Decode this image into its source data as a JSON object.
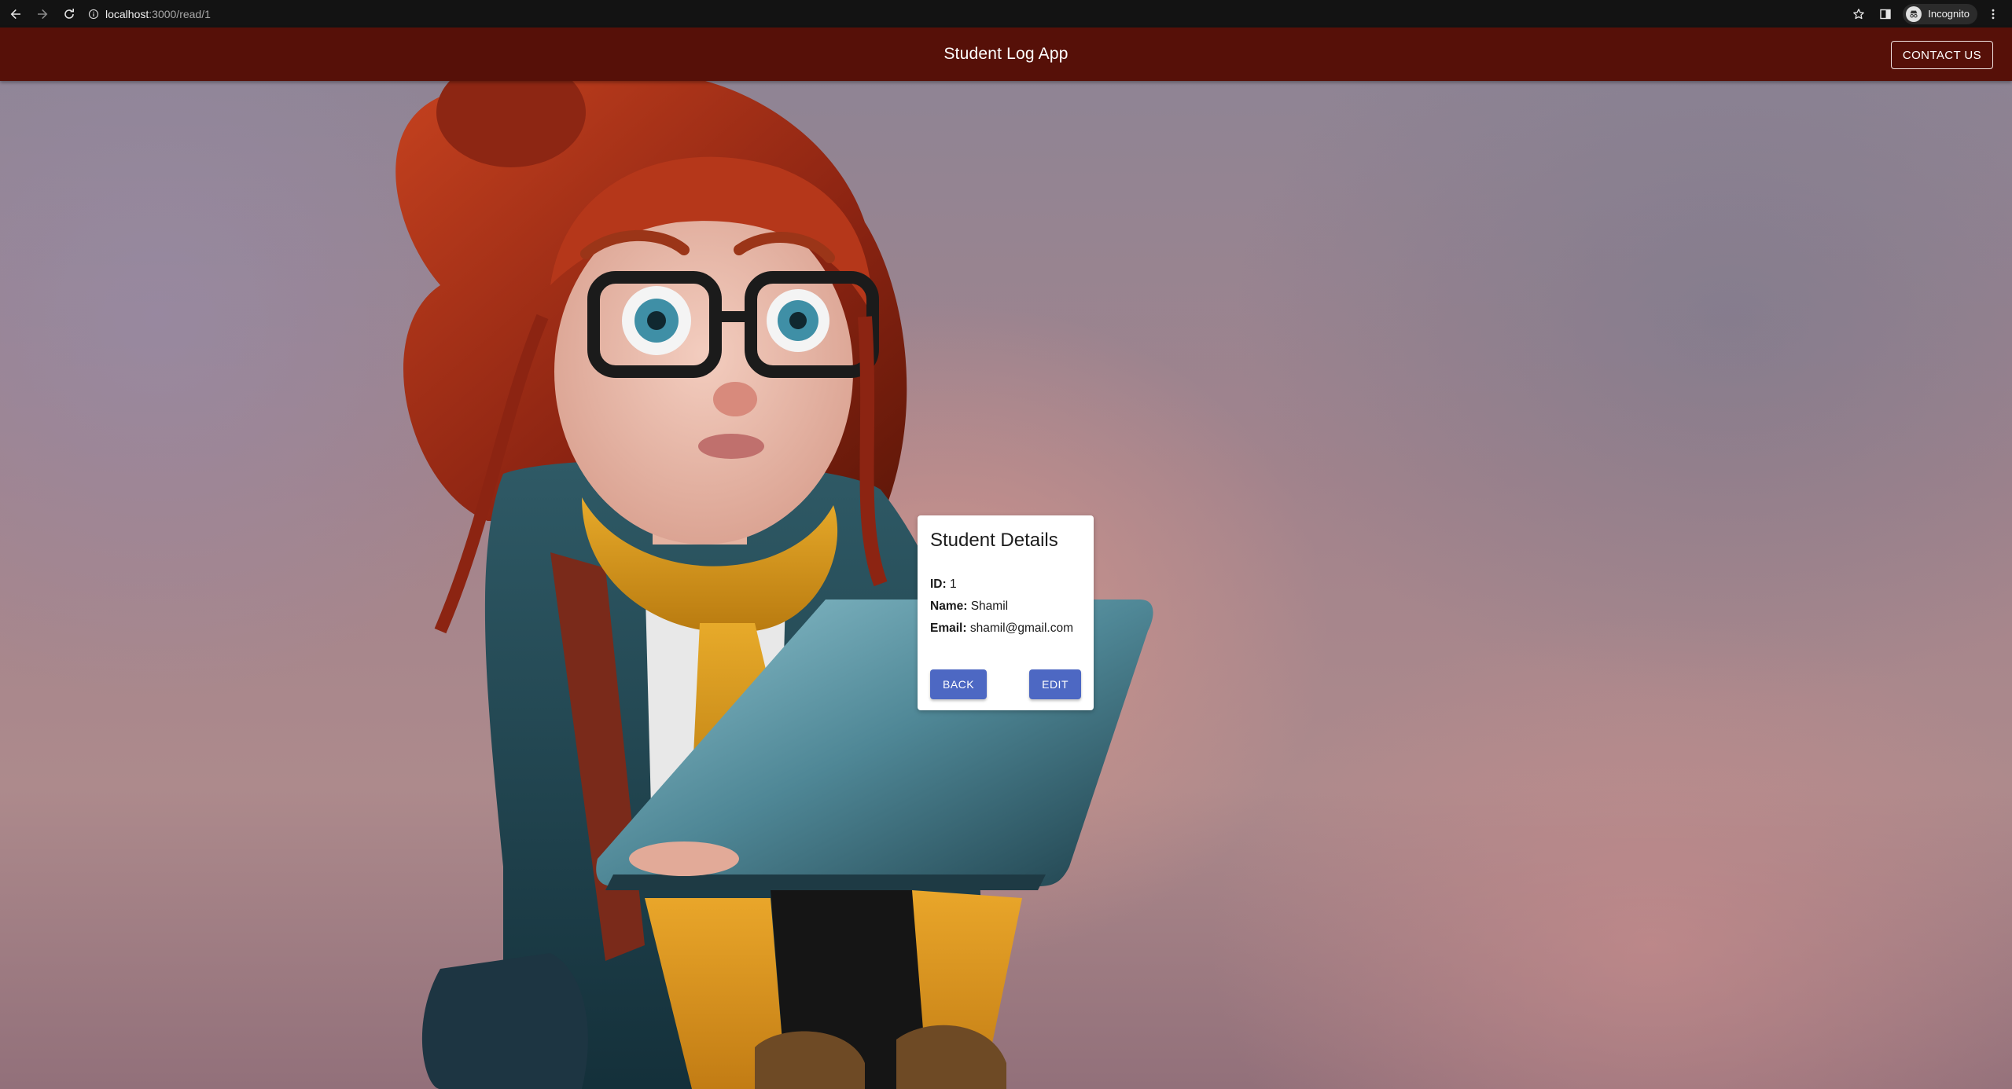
{
  "browser": {
    "url_host": "localhost",
    "url_path": ":3000/read/1",
    "incognito_label": "Incognito",
    "icons": [
      "back-arrow-icon",
      "forward-arrow-icon",
      "reload-icon",
      "info-icon",
      "star-icon",
      "side-panel-icon",
      "incognito-icon",
      "more-vert-icon"
    ]
  },
  "header": {
    "title": "Student Log App",
    "contact_label": "CONTACT US",
    "background_color": "#561008"
  },
  "card": {
    "title": "Student Details",
    "fields": [
      {
        "label": "ID:",
        "value": "1"
      },
      {
        "label": "Name:",
        "value": "Shamil"
      },
      {
        "label": "Email:",
        "value": "shamil@gmail.com"
      }
    ],
    "back_label": "BACK",
    "edit_label": "EDIT",
    "button_color": "#4d68c3"
  }
}
